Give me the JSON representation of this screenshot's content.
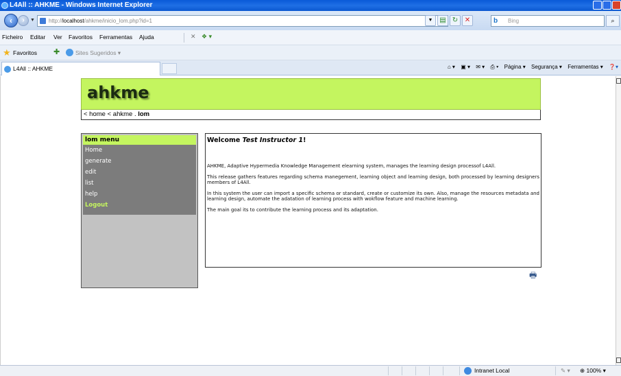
{
  "window": {
    "title": "L4All :: AHKME - Windows Internet Explorer"
  },
  "address": {
    "url_prefix": "http://",
    "url_host": "localhost",
    "url_path": "/ahkme/inicio_lom.php?id=1",
    "search_placeholder": "Bing",
    "search_brand": "b"
  },
  "menu": {
    "items": [
      "Ficheiro",
      "Editar",
      "Ver",
      "Favoritos",
      "Ferramentas",
      "Ajuda"
    ]
  },
  "favorites": {
    "label": "Favoritos",
    "suggested": "Sites Sugeridos ▾"
  },
  "tab": {
    "label": "L4All :: AHKME"
  },
  "commandbar": {
    "page": "Página ▾",
    "safety": "Segurança ▾",
    "tools": "Ferramentas ▾"
  },
  "site": {
    "logo": "ahkme",
    "breadcrumb": {
      "home": "< home",
      "ahkme": "< ahkme",
      "sep": ".",
      "current": "lom"
    }
  },
  "sidebar": {
    "title": "lom menu",
    "items": [
      {
        "label": "Home"
      },
      {
        "label": "generate"
      },
      {
        "label": "edit"
      },
      {
        "label": "list"
      },
      {
        "label": "help"
      },
      {
        "label": "Logout"
      }
    ]
  },
  "main": {
    "welcome_prefix": "Welcome ",
    "welcome_user": "Test Instructor 1",
    "welcome_suffix": "!",
    "paragraphs": [
      "AHKME, Adaptive Hypermedia Knowledge Management elearning system, manages the learning design processof L4All.",
      "This release gathers features regarding schema manegement, learning object and learning design, both processed by learning designers members of L4All.",
      "In this system the user can import a specific schema or standard, create or customize its own. Also, manage the resources metadata and learning design, automate the adatation of learning process with wokflow feature and machine learning.",
      "The main goal its to contribute the learning process and its adaptation."
    ]
  },
  "status": {
    "zone": "Intranet Local",
    "zoom": "100%"
  }
}
